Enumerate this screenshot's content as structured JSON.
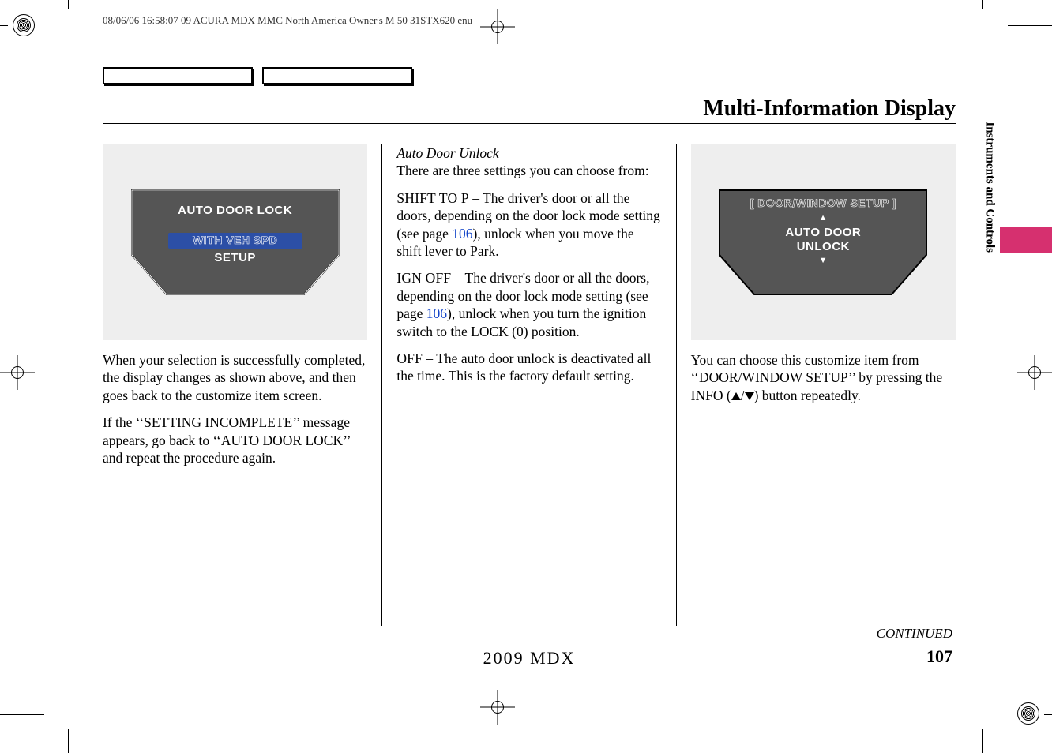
{
  "meta_header": "08/06/06 16:58:07   09 ACURA MDX MMC North America Owner's M 50 31STX620 enu",
  "page_title": "Multi-Information Display",
  "section_tab": "Instruments and Controls",
  "footer": {
    "continued": "CONTINUED",
    "page_number": "107",
    "model": "2009  MDX"
  },
  "col1": {
    "display": {
      "line1": "AUTO DOOR LOCK",
      "line2": "WITH VEH SPD",
      "line3": "SETUP"
    },
    "p1": "When your selection is successfully completed, the display changes as shown above, and then goes back to the customize item screen.",
    "p2": "If the ‘‘SETTING INCOMPLETE’’ message appears, go back to ‘‘AUTO DOOR LOCK’’ and repeat the procedure again."
  },
  "col2": {
    "subhead": "Auto Door Unlock",
    "intro": "There are three settings you can choose from:",
    "opt1_term": "SHIFT TO P",
    "opt1_dash": " – ",
    "opt1_body_a": "The driver's door or all the doors, depending on the door lock mode setting (see page ",
    "opt1_ref": "106",
    "opt1_body_b": "), unlock when you move the shift lever to Park.",
    "opt2_term": "IGN OFF",
    "opt2_dash": " – ",
    "opt2_body_a": "The driver's door or all the doors, depending on the door lock mode setting (see page ",
    "opt2_ref": "106",
    "opt2_body_b": "), unlock when you turn the ignition switch to the LOCK (0) position.",
    "opt3_term": "OFF",
    "opt3_dash": " – ",
    "opt3_body": "The auto door unlock is deactivated all the time. This is the factory default setting."
  },
  "col3": {
    "display": {
      "line1": "[ DOOR/WINDOW SETUP ]",
      "line2": "AUTO DOOR",
      "line3": "UNLOCK"
    },
    "p1_a": "You can choose this customize item from ‘‘DOOR/WINDOW SETUP’’ by pressing the INFO (",
    "p1_b": "/",
    "p1_c": ") button repeatedly."
  }
}
